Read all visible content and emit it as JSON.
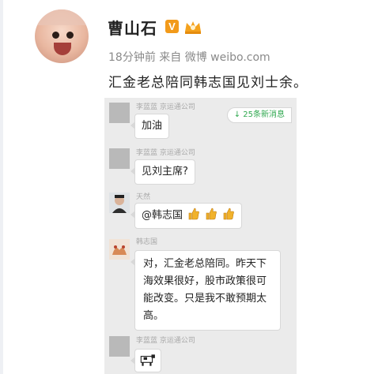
{
  "post": {
    "author": "曹山石",
    "meta": "18分钟前 来自 微博 weibo.com",
    "text": "汇金老总陪同韩志国见刘士余。"
  },
  "chat": {
    "new_messages": "↓ 25条新消息",
    "messages": [
      {
        "sender": "李蓝蓝 京运通公司",
        "text": "加油"
      },
      {
        "sender": "李蓝蓝 京运通公司",
        "text": "见刘主席?"
      },
      {
        "sender": "天然",
        "text": "@韩志国"
      },
      {
        "sender": "韩志国",
        "text": "对，汇金老总陪同。昨天下海效果很好，股市政策很可能改变。只是我不敢预期太高。"
      },
      {
        "sender": "李蓝蓝 京运通公司",
        "text": ""
      }
    ]
  },
  "colors": {
    "verified": "#f29a1a",
    "new_messages": "#2fa84f"
  }
}
